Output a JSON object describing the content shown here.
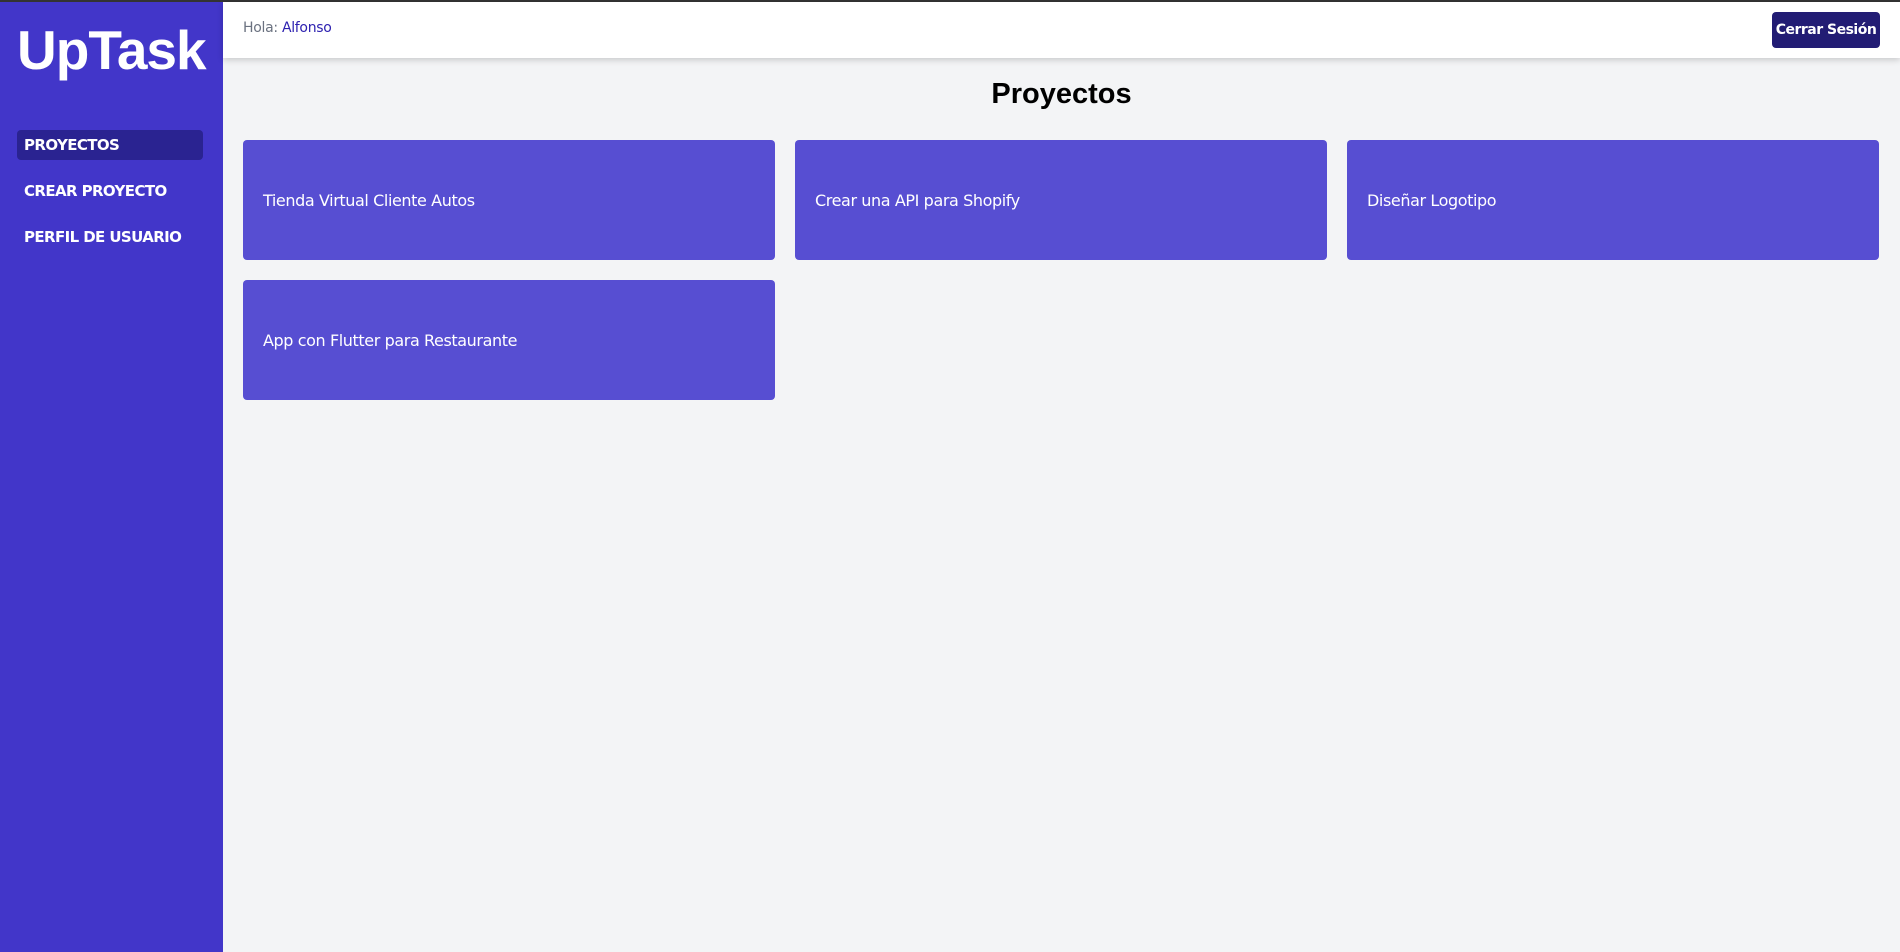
{
  "app": {
    "logo": "UpTask"
  },
  "sidebar": {
    "items": [
      {
        "label": "Proyectos",
        "active": true
      },
      {
        "label": "Crear Proyecto",
        "active": false
      },
      {
        "label": "Perfil de Usuario",
        "active": false
      }
    ]
  },
  "header": {
    "greeting_prefix": "Hola:",
    "user_name": "Alfonso",
    "logout_label": "Cerrar Sesión"
  },
  "main": {
    "title": "Proyectos",
    "projects": [
      {
        "name": "Tienda Virtual Cliente Autos"
      },
      {
        "name": "Crear una API para Shopify"
      },
      {
        "name": "Diseñar Logotipo"
      },
      {
        "name": "App con Flutter para Restaurante"
      }
    ]
  },
  "colors": {
    "sidebar_bg": "#4236c9",
    "active_nav_bg": "#2a2391",
    "card_bg": "#574ed2",
    "button_bg": "#221c74",
    "page_bg": "#f3f4f6"
  }
}
